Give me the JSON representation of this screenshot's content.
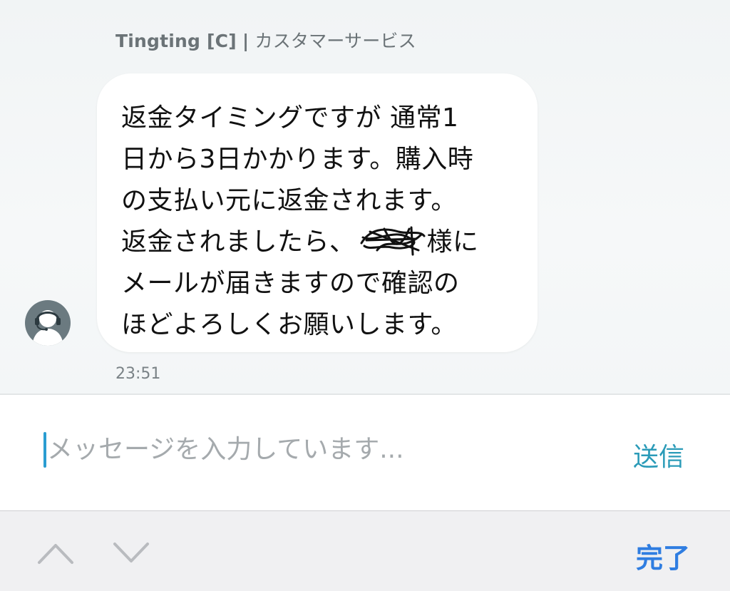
{
  "chat": {
    "sender_name": "Tingting [C]",
    "separator": "|",
    "sender_role": "カスタマーサービス",
    "message_lines": [
      "返金タイミングですが 通常1",
      "日から3日かかります。購入時",
      "の支払い元に返金されます。",
      "返金されましたら、",
      "様に",
      "メールが届きますので確認の",
      "ほどよろしくお願いします。"
    ],
    "timestamp": "23:51",
    "avatar_icon": "headset-agent-icon"
  },
  "composer": {
    "placeholder": "メッセージを入力しています...",
    "send_label": "送信"
  },
  "keyboard_toolbar": {
    "up_icon": "chevron-up-icon",
    "down_icon": "chevron-down-icon",
    "done_label": "完了"
  },
  "colors": {
    "accent_send": "#2b9bb8",
    "accent_done": "#2f7de1",
    "caret": "#2a9dd1"
  }
}
